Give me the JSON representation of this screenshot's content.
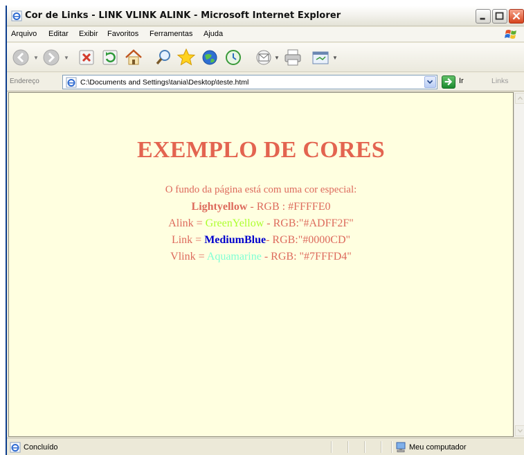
{
  "window": {
    "title": "Cor de Links - LINK VLINK ALINK - Microsoft Internet Explorer",
    "title_icon": "ie-page-icon"
  },
  "menu": [
    "Arquivo",
    "Editar",
    "Exibir",
    "Favoritos",
    "Ferramentas",
    "Ajuda"
  ],
  "toolbar_icons": [
    "back-icon",
    "forward-icon",
    "stop-icon",
    "refresh-icon",
    "home-icon",
    "search-icon",
    "favorites-icon",
    "media-icon",
    "history-icon",
    "mail-icon",
    "print-icon",
    "edit-icon"
  ],
  "address": {
    "label": "Endereço",
    "value": "C:\\Documents and Settings\\tania\\Desktop\\teste.html",
    "go_label": "Ir",
    "links_label": "Links"
  },
  "page": {
    "background": "#FFFFE0",
    "title": "EXEMPLO DE CORES",
    "line1": "O fundo da página está com uma cor especial:",
    "line2_bold": "Lightyellow",
    "line2_rest": " - RGB : #FFFFE0",
    "line3_prefix": "Alink = ",
    "line3_name": "GreenYellow",
    "line3_rest": " - RGB:\"#ADFF2F\"",
    "line4_prefix": "Link = ",
    "line4_name": "MediumBlue",
    "line4_rest": "- RGB:\"#0000CD\"",
    "line5_prefix": "Vlink = ",
    "line5_name": "Aquamarine",
    "line5_rest": " - RGB: \"#7FFFD4\"",
    "colors": {
      "text": "#dd6a5c",
      "alink": "#ADFF2F",
      "link": "#0000CD",
      "vlink": "#7FFFD4"
    }
  },
  "status": {
    "text": "Concluído",
    "zone": "Meu computador"
  }
}
